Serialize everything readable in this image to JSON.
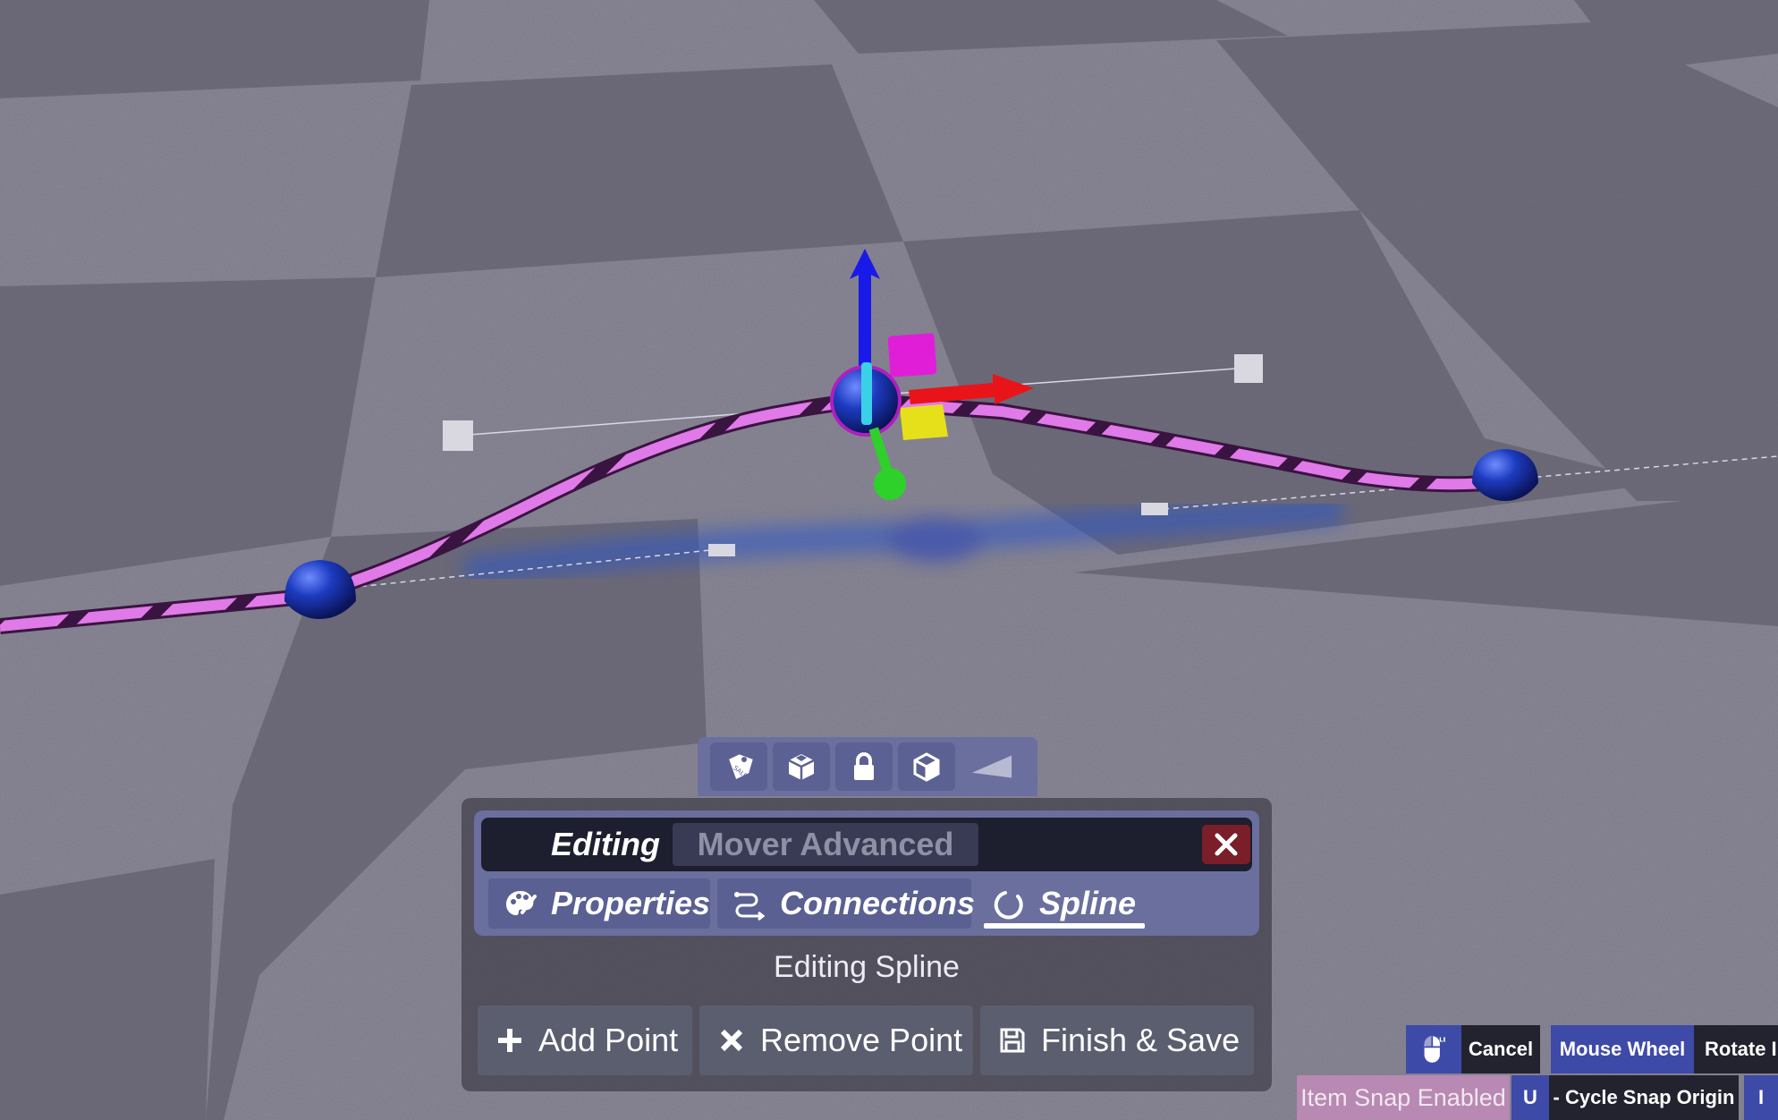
{
  "toolbar": {
    "buttons": [
      {
        "icon": "sale-tag-icon"
      },
      {
        "icon": "package-icon"
      },
      {
        "icon": "lock-icon"
      },
      {
        "icon": "cube-icon"
      },
      {
        "icon": "collapse-arrow-icon"
      }
    ]
  },
  "panel": {
    "title_label": "Editing",
    "item_name": "Mover Advanced",
    "close_icon": "close-icon",
    "tabs": [
      {
        "label": "Properties",
        "icon": "palette-icon",
        "active": false
      },
      {
        "label": "Connections",
        "icon": "connections-icon",
        "active": false
      },
      {
        "label": "Spline",
        "icon": "spline-loop-icon",
        "active": true
      }
    ],
    "status": "Editing Spline",
    "actions": [
      {
        "label": "Add Point",
        "icon": "plus-icon"
      },
      {
        "label": "Remove Point",
        "icon": "x-icon"
      },
      {
        "label": "Finish & Save",
        "icon": "save-icon"
      }
    ]
  },
  "hints": {
    "row1": {
      "mouse_icon": "mouse-icon",
      "cancel": "Cancel",
      "mouse_wheel": "Mouse Wheel",
      "rotate": "Rotate I"
    },
    "row2": {
      "snap_status": "Item Snap Enabled",
      "key_u": "U",
      "cycle": "- Cycle Snap Origin",
      "key_i": "I"
    }
  },
  "colors": {
    "spline": "#e07ae8",
    "spline_point": "#1d3bc0",
    "gizmo_x": "#e8141a",
    "gizmo_y": "#2ed12a",
    "gizmo_z": "#1a1ae8",
    "panel_accent": "#6a6f9e",
    "close_button": "#7a1e29"
  }
}
